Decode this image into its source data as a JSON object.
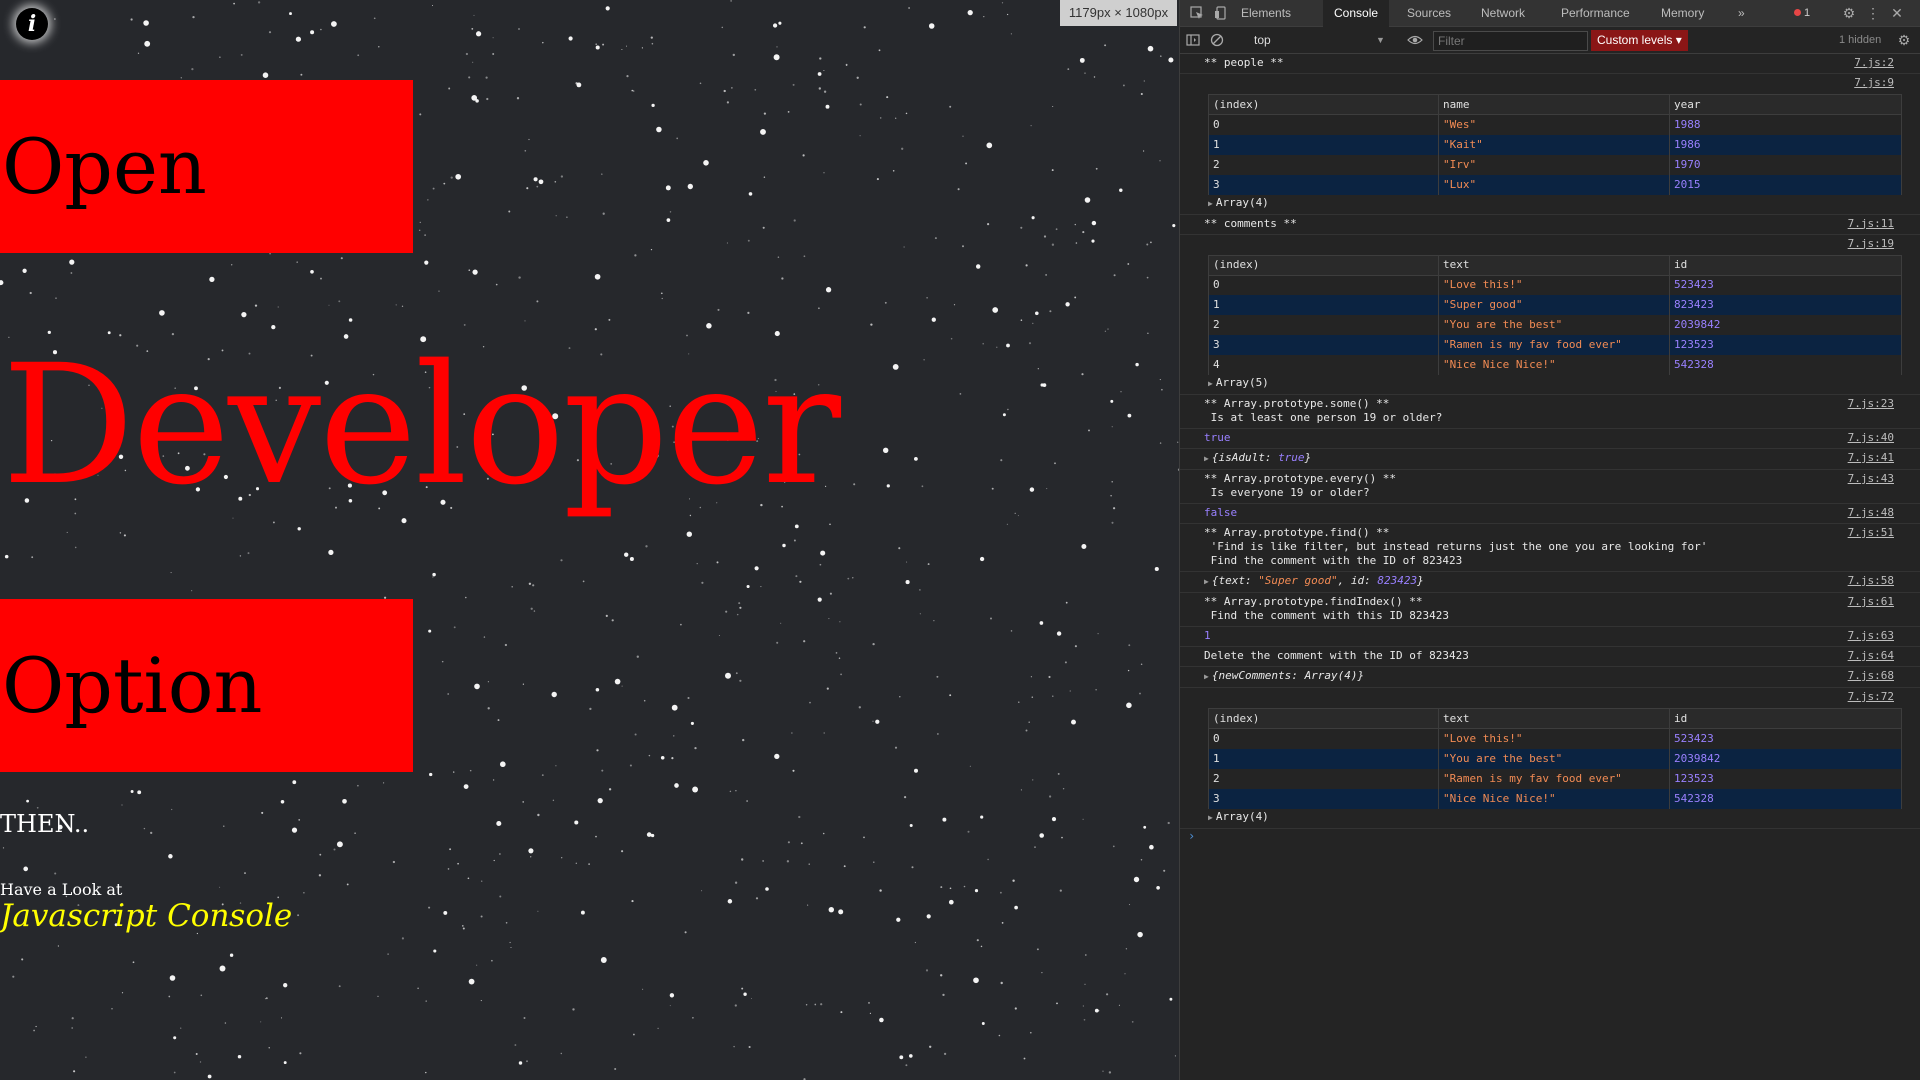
{
  "page": {
    "info_icon": "i",
    "box1": "Open",
    "big_word": "Developer",
    "box2": "Option",
    "then": "THEN..",
    "look": "Have a Look at",
    "console_link": "Javascript Console",
    "colors": {
      "red": "#ff0000",
      "link_yellow": "#ffff00",
      "background": "#26282c"
    }
  },
  "size_badge": "1179px × 1080px",
  "devtools": {
    "tabs": [
      "Elements",
      "Console",
      "Sources",
      "Network",
      "Performance",
      "Memory"
    ],
    "active_tab": "Console",
    "more_tabs_icon": "»",
    "error_count": "1",
    "context": "top",
    "filter_placeholder": "Filter",
    "levels": "Custom levels ▾",
    "hidden": "1 hidden",
    "icons": [
      "inspect-icon",
      "device-toggle-icon",
      "sidebar-toggle-icon",
      "clear-console-icon",
      "eye-icon",
      "settings-icon",
      "more-menu-icon",
      "close-icon"
    ]
  },
  "console": {
    "people_header": {
      "text": "** people **",
      "src": "7.js:2"
    },
    "people_table": {
      "src": "7.js:9",
      "headers": [
        "(index)",
        "name",
        "year"
      ],
      "rows": [
        [
          "0",
          "\"Wes\"",
          "1988"
        ],
        [
          "1",
          "\"Kait\"",
          "1986"
        ],
        [
          "2",
          "\"Irv\"",
          "1970"
        ],
        [
          "3",
          "\"Lux\"",
          "2015"
        ]
      ],
      "footer": "Array(4)"
    },
    "comments_header": {
      "text": "** comments **",
      "src": "7.js:11"
    },
    "comments_table": {
      "src": "7.js:19",
      "headers": [
        "(index)",
        "text",
        "id"
      ],
      "rows": [
        [
          "0",
          "\"Love this!\"",
          "523423"
        ],
        [
          "1",
          "\"Super good\"",
          "823423"
        ],
        [
          "2",
          "\"You are the best\"",
          "2039842"
        ],
        [
          "3",
          "\"Ramen is my fav food ever\"",
          "123523"
        ],
        [
          "4",
          "\"Nice Nice Nice!\"",
          "542328"
        ]
      ],
      "footer": "Array(5)"
    },
    "some_header": {
      "text": "** Array.prototype.some() **\n Is at least one person 19 or older?",
      "src": "7.js:23"
    },
    "some_result": {
      "text": "true",
      "src": "7.js:40"
    },
    "is_adult": {
      "key": "isAdult",
      "value": "true",
      "src": "7.js:41"
    },
    "every_header": {
      "text": "** Array.prototype.every() **\n Is everyone 19 or older?",
      "src": "7.js:43"
    },
    "every_result": {
      "text": "false",
      "src": "7.js:48"
    },
    "find_header": {
      "text": "** Array.prototype.find() **\n 'Find is like filter, but instead returns just the one you are looking for'\n Find the comment with the ID of 823423",
      "src": "7.js:51"
    },
    "find_result": {
      "text_value": "\"Super good\"",
      "id_value": "823423",
      "src": "7.js:58"
    },
    "findindex_header": {
      "text": "** Array.prototype.findIndex() **\n Find the comment with this ID 823423",
      "src": "7.js:61"
    },
    "findindex_result": {
      "text": "1",
      "src": "7.js:63"
    },
    "delete_msg": {
      "text": "Delete the comment with the ID of 823423",
      "src": "7.js:64"
    },
    "new_comments": {
      "key": "newComments",
      "value": "Array(4)",
      "src": "7.js:68"
    },
    "new_table": {
      "src": "7.js:72",
      "headers": [
        "(index)",
        "text",
        "id"
      ],
      "rows": [
        [
          "0",
          "\"Love this!\"",
          "523423"
        ],
        [
          "1",
          "\"You are the best\"",
          "2039842"
        ],
        [
          "2",
          "\"Ramen is my fav food ever\"",
          "123523"
        ],
        [
          "3",
          "\"Nice Nice Nice!\"",
          "542328"
        ]
      ],
      "footer": "Array(4)"
    },
    "prompt": "›"
  }
}
